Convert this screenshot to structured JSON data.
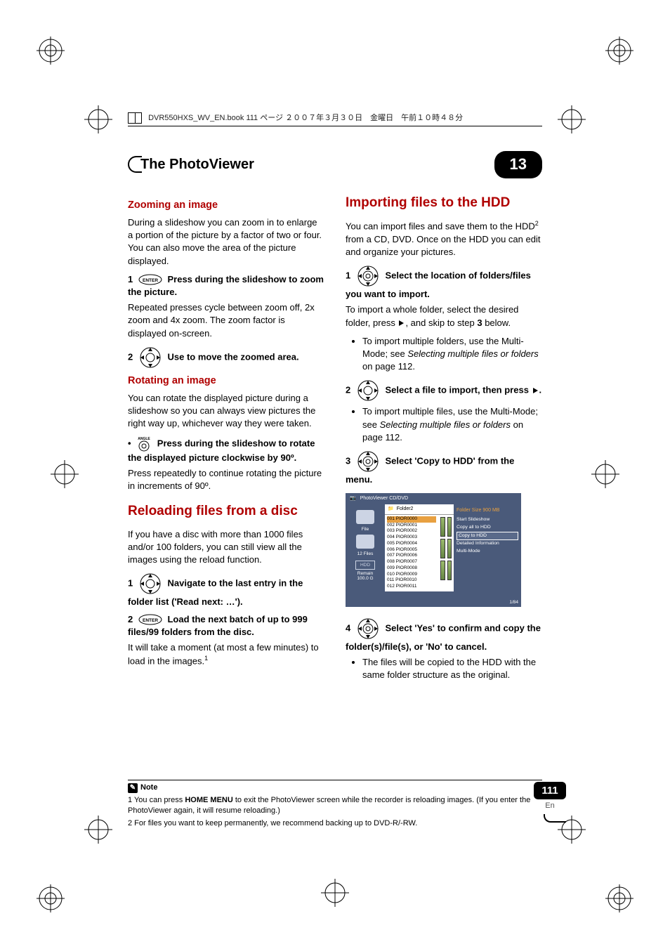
{
  "header": {
    "file_line": "DVR550HXS_WV_EN.book  111 ページ  ２００７年３月３０日　金曜日　午前１０時４８分"
  },
  "title": {
    "section": "The PhotoViewer",
    "chapter": "13"
  },
  "left_col": {
    "h_zoom": "Zooming an image",
    "p_zoom": "During a slideshow you can zoom in to enlarge a portion of the picture by a factor of two or four. You can also move the area of the picture displayed.",
    "step1a_num": "1",
    "step1a_icon": "ENTER",
    "step1a_text": "Press during the slideshow to zoom the picture.",
    "p_zoom_after": "Repeated presses cycle between zoom off, 2x zoom and 4x zoom. The zoom factor is displayed on-screen.",
    "step2a_num": "2",
    "step2a_text": "Use to move the zoomed area.",
    "h_rotate": "Rotating an image",
    "p_rotate": "You can rotate the displayed picture during a slideshow so you can always view pictures the right way up, whichever way they were taken.",
    "rot_icon": "ANGLE",
    "rot_bold": "Press during the slideshow to rotate the displayed picture clockwise by 90º.",
    "rot_after": "Press repeatedly to continue rotating the picture in increments of 90º.",
    "h_reload": "Reloading files from a disc",
    "p_reload": "If you have a disc with more than 1000 files and/or 100 folders, you can still view all the images using the reload function.",
    "stepR1_num": "1",
    "stepR1_text": "Navigate to the last entry in the folder list ('Read next: …').",
    "stepR2_num": "2",
    "stepR2_icon": "ENTER",
    "stepR2_text": "Load the next batch of up to 999 files/99 folders from the disc.",
    "p_reload_after_a": "It will take a moment (at most a few minutes) to load in the images.",
    "p_reload_after_sup": "1"
  },
  "right_col": {
    "h_import": "Importing files to the HDD",
    "p_import_a": "You can import files and save them to the HDD",
    "p_import_sup": "2",
    "p_import_b": " from a CD, DVD. Once on the HDD you can edit and organize your pictures.",
    "step1_num": "1",
    "step1_text": "Select the location of folders/files you want to import.",
    "p1a": "To import a whole folder, select the desired folder, press ",
    "p1b": ", and skip to step ",
    "p1b_bold": "3",
    "p1c": " below.",
    "li1_a": "To import multiple folders, use the Multi-Mode; see ",
    "li1_i": "Selecting multiple files or folders",
    "li1_b": " on page 112.",
    "step2_num": "2",
    "step2_text": "Select a file to import, then press ",
    "step2_text_end": ".",
    "li2_a": "To import multiple files, use the Multi-Mode; see ",
    "li2_i": "Selecting multiple files or folders",
    "li2_b": " on page 112.",
    "step3_num": "3",
    "step3_text": "Select 'Copy to HDD' from the menu.",
    "step4_num": "4",
    "step4_text": "Select 'Yes' to confirm and copy the folder(s)/file(s), or 'No' to cancel.",
    "li4": "The files will be copied to the HDD with the same folder structure as the original."
  },
  "screenshot": {
    "title": "PhotoViewer  CD/DVD",
    "folder": "Folder2",
    "folder_size": "Folder Size 900 MB",
    "left_file": "File",
    "left_files": "12 Files",
    "left_hdd": "HDD",
    "left_remain": "Remain",
    "left_remain_val": "100.0 G",
    "menu": {
      "start": "Start Slideshow",
      "copyall": "Copy all to HDD",
      "copy": "Copy to HDD",
      "detail": "Detailed Information",
      "multi": "Multi-Mode"
    },
    "files": [
      "001 PIOR0000",
      "002 PIOR0001",
      "003 PIOR0002",
      "004 PIOR0003",
      "005 PIOR0004",
      "006 PIOR0005",
      "007 PIOR0006",
      "008 PIOR0007",
      "009 PIOR0008",
      "010 PIOR0009",
      "011 PIOR0010",
      "012 PIOR0011"
    ],
    "pager": "1/84"
  },
  "footnotes": {
    "label": "Note",
    "f1_a": "1 You can press ",
    "f1_bold": "HOME MENU",
    "f1_b": " to exit the PhotoViewer screen while the recorder is reloading images. (If you enter the PhotoViewer again, it will resume reloading.)",
    "f2": "2 For files you want to keep permanently, we recommend backing up to DVD-R/-RW."
  },
  "page_number": {
    "num": "111",
    "lang": "En"
  }
}
